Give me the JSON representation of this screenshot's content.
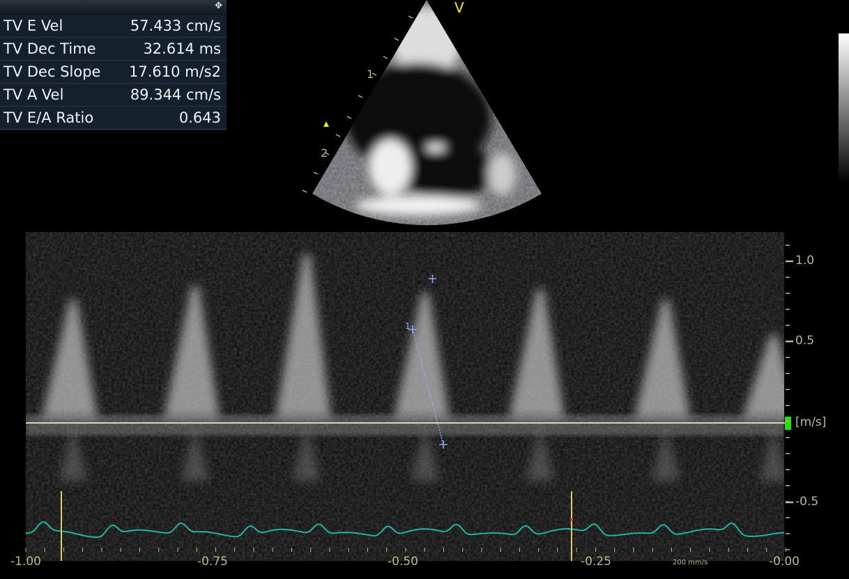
{
  "measurements": {
    "rows": [
      {
        "label": "TV E Vel",
        "value": "57.433 cm/s"
      },
      {
        "label": "TV Dec Time",
        "value": "32.614 ms"
      },
      {
        "label": "TV Dec Slope",
        "value": "17.610 m/s2"
      },
      {
        "label": "TV A Vel",
        "value": "89.344 cm/s"
      },
      {
        "label": "TV E/A Ratio",
        "value": "0.643"
      }
    ],
    "move_icon": "move-icon"
  },
  "image": {
    "orientation_marker": "V",
    "depth_labels": [
      "1",
      "2"
    ]
  },
  "doppler": {
    "velocity_ticks": [
      "1.0",
      "0.5",
      "-0.5"
    ],
    "unit": "[m/s]",
    "time_ticks": [
      "-1.00",
      "-0.75",
      "-0.50",
      "-0.25",
      "-0.00"
    ],
    "sweep_speed": "200 mm/s",
    "caliper_label": "1"
  },
  "colors": {
    "axis": "#bdb88a",
    "ecg": "#1fb5a8",
    "caliper": "#8fa8ff",
    "marker": "#d8d060"
  }
}
